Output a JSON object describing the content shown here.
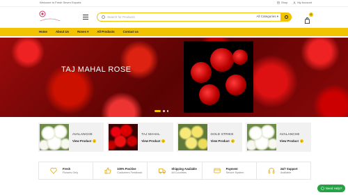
{
  "topbar": {
    "welcome": "Welcome to Fresh Seven Exports",
    "shop": "Shop",
    "account": "My Account"
  },
  "header": {
    "logo_alt": "Fresh Seven Exports",
    "search_placeholder": "Search for Products",
    "category_select": "All Categories",
    "cart_count": "0"
  },
  "nav": {
    "items": [
      "Home",
      "About Us",
      "Roses",
      "All Products",
      "Contact us"
    ]
  },
  "hero": {
    "title": "TAJ MAHAL ROSE"
  },
  "products": [
    {
      "name": "AVALANCHE",
      "action": "View Product"
    },
    {
      "name": "TAJ MAHAL",
      "action": "View Product"
    },
    {
      "name": "GOLD STRIKE",
      "action": "View Product"
    },
    {
      "name": "AVALANCHE",
      "action": "View Product"
    }
  ],
  "features": [
    {
      "title": "Fresh",
      "subtitle": "Flowers Only",
      "icon": "heart-icon"
    },
    {
      "title": "100% Positive",
      "subtitle": "Customers Feedback",
      "icon": "thumbs-up-icon"
    },
    {
      "title": "Shipping Available",
      "subtitle": "All Countries",
      "icon": "truck-icon"
    },
    {
      "title": "Payment",
      "subtitle": "Secure System",
      "icon": "credit-card-icon"
    },
    {
      "title": "24/7 Support",
      "subtitle": "Available",
      "icon": "headset-icon"
    }
  ],
  "help_button": "Need Help?",
  "colors": {
    "accent": "#f2c300",
    "help": "#25a244",
    "hero_bg": "#7a0a0a"
  }
}
